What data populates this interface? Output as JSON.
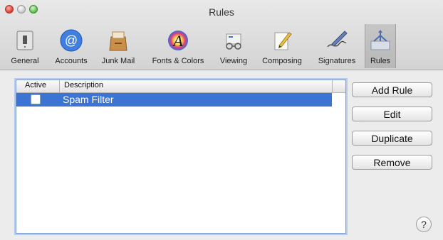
{
  "window": {
    "title": "Rules"
  },
  "toolbar": {
    "items": [
      {
        "label": "General",
        "icon": "general-switch-icon"
      },
      {
        "label": "Accounts",
        "icon": "at-sign-icon"
      },
      {
        "label": "Junk Mail",
        "icon": "junk-mail-bag-icon"
      },
      {
        "label": "Fonts & Colors",
        "icon": "fonts-colors-icon"
      },
      {
        "label": "Viewing",
        "icon": "glasses-icon"
      },
      {
        "label": "Composing",
        "icon": "pencil-paper-icon"
      },
      {
        "label": "Signatures",
        "icon": "pen-signature-icon"
      },
      {
        "label": "Rules",
        "icon": "rules-arrows-icon"
      }
    ],
    "selected": "Rules"
  },
  "rules_table": {
    "headers": {
      "active": "Active",
      "description": "Description"
    },
    "rows": [
      {
        "active": false,
        "description": "Spam Filter",
        "selected": true
      }
    ]
  },
  "buttons": {
    "add_rule": "Add Rule",
    "edit": "Edit",
    "duplicate": "Duplicate",
    "remove": "Remove",
    "help": "?"
  },
  "colors": {
    "selection": "#3b74d2",
    "focus_ring": "#7f9bd0"
  }
}
